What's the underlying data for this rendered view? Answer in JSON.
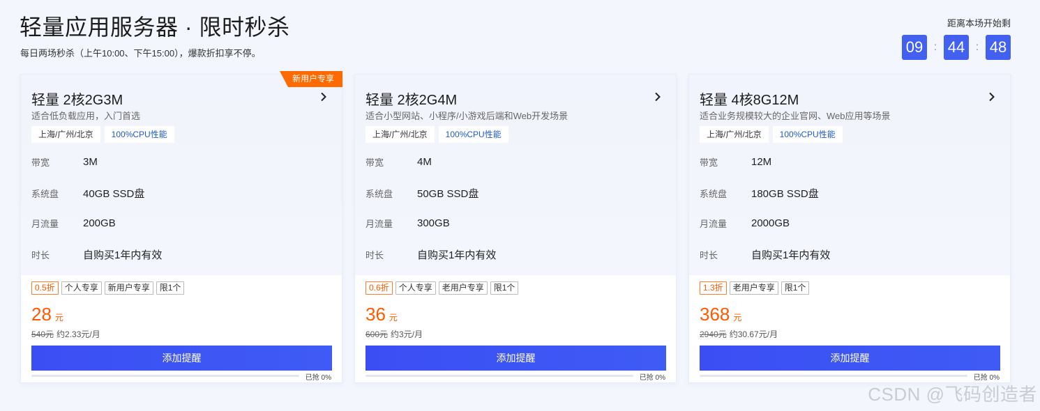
{
  "header": {
    "title": "轻量应用服务器 · 限时秒杀",
    "subtitle": "每日两场秒杀（上午10:00、下午15:00），爆款折扣享不停。",
    "countdown_label": "距离本场开始剩",
    "countdown": {
      "h": "09",
      "m": "44",
      "s": "48",
      "sep": ":"
    }
  },
  "cards": [
    {
      "badge": "新用户专享",
      "name": "轻量 2核2G3M",
      "desc": "适合低负载应用，入门首选",
      "tags": [
        "上海/广州/北京",
        "100%CPU性能"
      ],
      "specs": [
        {
          "k": "带宽",
          "v": "3M"
        },
        {
          "k": "系统盘",
          "v": "40GB SSD盘"
        },
        {
          "k": "月流量",
          "v": "200GB"
        },
        {
          "k": "时长",
          "v": "自购买1年内有效"
        }
      ],
      "price_tags": [
        "0.5折",
        "个人专享",
        "新用户专享",
        "限1个"
      ],
      "price": "28",
      "unit": "元",
      "orig_price": "540元",
      "monthly": "约2.33元/月",
      "button": "添加提醒",
      "sold_pct": 0,
      "sold": "已抢 0%"
    },
    {
      "badge": "",
      "name": "轻量 2核2G4M",
      "desc": "适合小型网站、小程序/小游戏后端和Web开发场景",
      "tags": [
        "上海/广州/北京",
        "100%CPU性能"
      ],
      "specs": [
        {
          "k": "带宽",
          "v": "4M"
        },
        {
          "k": "系统盘",
          "v": "50GB SSD盘"
        },
        {
          "k": "月流量",
          "v": "300GB"
        },
        {
          "k": "时长",
          "v": "自购买1年内有效"
        }
      ],
      "price_tags": [
        "0.6折",
        "个人专享",
        "老用户专享",
        "限1个"
      ],
      "price": "36",
      "unit": "元",
      "orig_price": "600元",
      "monthly": "约3元/月",
      "button": "添加提醒",
      "sold_pct": 0,
      "sold": "已抢 0%"
    },
    {
      "badge": "",
      "name": "轻量 4核8G12M",
      "desc": "适合业务规模较大的企业官网、Web应用等场景",
      "tags": [
        "上海/广州/北京",
        "100%CPU性能"
      ],
      "specs": [
        {
          "k": "带宽",
          "v": "12M"
        },
        {
          "k": "系统盘",
          "v": "180GB SSD盘"
        },
        {
          "k": "月流量",
          "v": "2000GB"
        },
        {
          "k": "时长",
          "v": "自购买1年内有效"
        }
      ],
      "price_tags": [
        "1.3折",
        "老用户专享",
        "限1个"
      ],
      "price": "368",
      "unit": "元",
      "orig_price": "2940元",
      "monthly": "约30.67元/月",
      "button": "添加提醒",
      "sold_pct": 0,
      "sold": "已抢 0%"
    }
  ],
  "watermark": "CSDN @飞码创造者",
  "colors": {
    "accent": "#3b4ef4",
    "price": "#ff5a00",
    "badge": "#ff6a00"
  },
  "icons": {
    "card_link": "chevron-right-icon"
  }
}
